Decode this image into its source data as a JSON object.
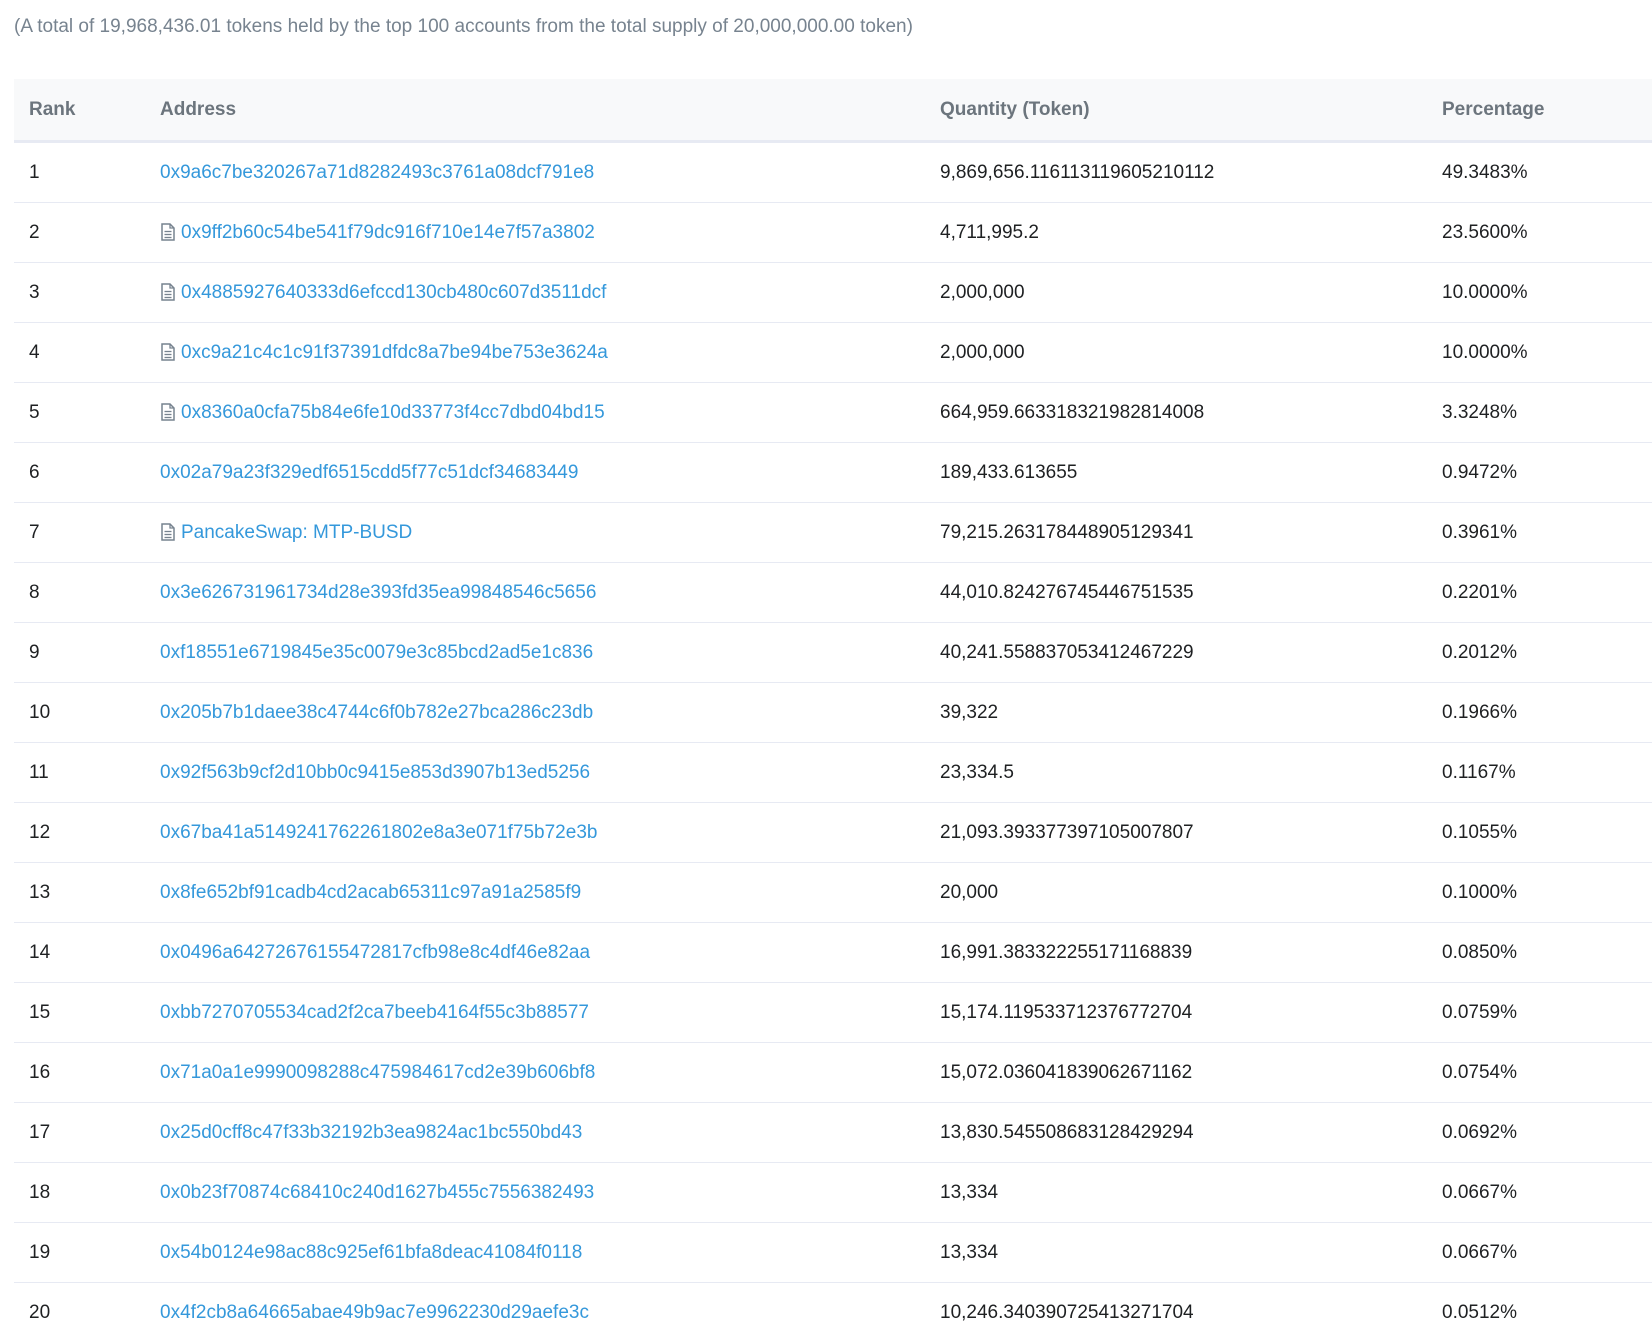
{
  "summary": "(A total of 19,968,436.01 tokens held by the top 100 accounts from the total supply of 20,000,000.00 token)",
  "table": {
    "headers": {
      "rank": "Rank",
      "address": "Address",
      "quantity": "Quantity (Token)",
      "percentage": "Percentage"
    },
    "rows": [
      {
        "rank": "1",
        "address": "0x9a6c7be320267a71d8282493c3761a08dcf791e8",
        "contract": false,
        "quantity": "9,869,656.116113119605210112",
        "percentage": "49.3483%"
      },
      {
        "rank": "2",
        "address": "0x9ff2b60c54be541f79dc916f710e14e7f57a3802",
        "contract": true,
        "quantity": "4,711,995.2",
        "percentage": "23.5600%"
      },
      {
        "rank": "3",
        "address": "0x4885927640333d6efccd130cb480c607d3511dcf",
        "contract": true,
        "quantity": "2,000,000",
        "percentage": "10.0000%"
      },
      {
        "rank": "4",
        "address": "0xc9a21c4c1c91f37391dfdc8a7be94be753e3624a",
        "contract": true,
        "quantity": "2,000,000",
        "percentage": "10.0000%"
      },
      {
        "rank": "5",
        "address": "0x8360a0cfa75b84e6fe10d33773f4cc7dbd04bd15",
        "contract": true,
        "quantity": "664,959.663318321982814008",
        "percentage": "3.3248%"
      },
      {
        "rank": "6",
        "address": "0x02a79a23f329edf6515cdd5f77c51dcf34683449",
        "contract": false,
        "quantity": "189,433.613655",
        "percentage": "0.9472%"
      },
      {
        "rank": "7",
        "address": "PancakeSwap: MTP-BUSD",
        "contract": true,
        "quantity": "79,215.263178448905129341",
        "percentage": "0.3961%"
      },
      {
        "rank": "8",
        "address": "0x3e626731961734d28e393fd35ea99848546c5656",
        "contract": false,
        "quantity": "44,010.824276745446751535",
        "percentage": "0.2201%"
      },
      {
        "rank": "9",
        "address": "0xf18551e6719845e35c0079e3c85bcd2ad5e1c836",
        "contract": false,
        "quantity": "40,241.558837053412467229",
        "percentage": "0.2012%"
      },
      {
        "rank": "10",
        "address": "0x205b7b1daee38c4744c6f0b782e27bca286c23db",
        "contract": false,
        "quantity": "39,322",
        "percentage": "0.1966%"
      },
      {
        "rank": "11",
        "address": "0x92f563b9cf2d10bb0c9415e853d3907b13ed5256",
        "contract": false,
        "quantity": "23,334.5",
        "percentage": "0.1167%"
      },
      {
        "rank": "12",
        "address": "0x67ba41a5149241762261802e8a3e071f75b72e3b",
        "contract": false,
        "quantity": "21,093.393377397105007807",
        "percentage": "0.1055%"
      },
      {
        "rank": "13",
        "address": "0x8fe652bf91cadb4cd2acab65311c97a91a2585f9",
        "contract": false,
        "quantity": "20,000",
        "percentage": "0.1000%"
      },
      {
        "rank": "14",
        "address": "0x0496a64272676155472817cfb98e8c4df46e82aa",
        "contract": false,
        "quantity": "16,991.383322255171168839",
        "percentage": "0.0850%"
      },
      {
        "rank": "15",
        "address": "0xbb7270705534cad2f2ca7beeb4164f55c3b88577",
        "contract": false,
        "quantity": "15,174.119533712376772704",
        "percentage": "0.0759%"
      },
      {
        "rank": "16",
        "address": "0x71a0a1e9990098288c475984617cd2e39b606bf8",
        "contract": false,
        "quantity": "15,072.036041839062671162",
        "percentage": "0.0754%"
      },
      {
        "rank": "17",
        "address": "0x25d0cff8c47f33b32192b3ea9824ac1bc550bd43",
        "contract": false,
        "quantity": "13,830.545508683128429294",
        "percentage": "0.0692%"
      },
      {
        "rank": "18",
        "address": "0x0b23f70874c68410c240d1627b455c7556382493",
        "contract": false,
        "quantity": "13,334",
        "percentage": "0.0667%"
      },
      {
        "rank": "19",
        "address": "0x54b0124e98ac88c925ef61bfa8deac41084f0118",
        "contract": false,
        "quantity": "13,334",
        "percentage": "0.0667%"
      },
      {
        "rank": "20",
        "address": "0x4f2cb8a64665abae49b9ac7e9962230d29aefe3c",
        "contract": false,
        "quantity": "10,246.340390725413271704",
        "percentage": "0.0512%"
      }
    ]
  },
  "icons": {
    "contract": "file-contract-icon"
  },
  "colors": {
    "link": "#3498db",
    "header_bg": "#f8f9fa",
    "muted": "#77838f"
  }
}
